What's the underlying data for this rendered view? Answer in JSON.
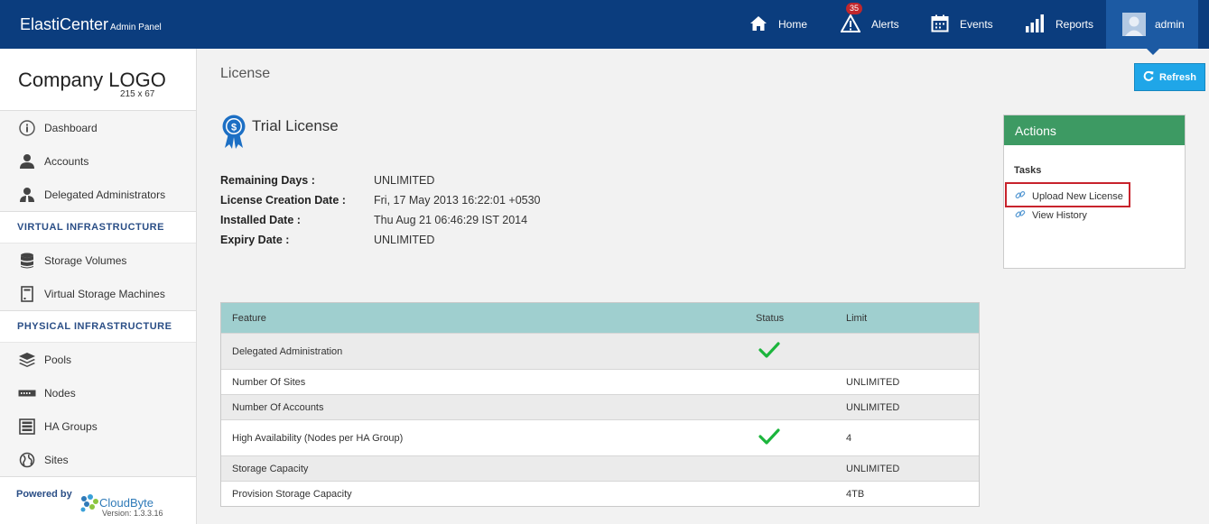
{
  "header": {
    "brand": "ElastiCenter",
    "brand_sub": "Admin Panel",
    "nav": [
      {
        "label": "Home",
        "icon": "home-icon"
      },
      {
        "label": "Alerts",
        "icon": "alert-icon",
        "badge": "35"
      },
      {
        "label": "Events",
        "icon": "calendar-icon"
      },
      {
        "label": "Reports",
        "icon": "bar-chart-icon"
      }
    ],
    "user": "admin"
  },
  "sidebar": {
    "logo": "Company LOGO",
    "logo_size": "215 x 67",
    "items_top": [
      "Dashboard",
      "Accounts",
      "Delegated Administrators"
    ],
    "section_virtual": "VIRTUAL INFRASTRUCTURE",
    "items_virtual": [
      "Storage Volumes",
      "Virtual Storage Machines"
    ],
    "section_physical": "PHYSICAL INFRASTRUCTURE",
    "items_physical": [
      "Pools",
      "Nodes",
      "HA Groups",
      "Sites"
    ],
    "powered_by": "Powered by",
    "vendor": "CloudByte",
    "version": "Version: 1.3.3.16"
  },
  "main": {
    "title": "License",
    "refresh": "Refresh",
    "license_title": "Trial License",
    "details": [
      {
        "key": "Remaining Days :",
        "value": "UNLIMITED"
      },
      {
        "key": "License Creation Date :",
        "value": "Fri, 17 May 2013 16:22:01 +0530"
      },
      {
        "key": "Installed Date :",
        "value": "Thu Aug 21 06:46:29 IST 2014"
      },
      {
        "key": "Expiry Date :",
        "value": "UNLIMITED"
      }
    ],
    "table": {
      "headers": [
        "Feature",
        "Status",
        "Limit"
      ],
      "rows": [
        {
          "feature": "Delegated Administration",
          "status": "check",
          "limit": ""
        },
        {
          "feature": "Number Of Sites",
          "status": "",
          "limit": "UNLIMITED"
        },
        {
          "feature": "Number Of Accounts",
          "status": "",
          "limit": "UNLIMITED"
        },
        {
          "feature": "High Availability (Nodes per HA Group)",
          "status": "check",
          "limit": "4"
        },
        {
          "feature": "Storage Capacity",
          "status": "",
          "limit": "UNLIMITED"
        },
        {
          "feature": "Provision Storage Capacity",
          "status": "",
          "limit": "4TB"
        }
      ]
    }
  },
  "actions": {
    "title": "Actions",
    "tasks": "Tasks",
    "links": [
      "Upload New License",
      "View History"
    ]
  },
  "colors": {
    "topbar": "#0b3d7e",
    "admin_box": "#1c5aa3",
    "refresh": "#1fa6e8",
    "actions_header": "#3d9a63",
    "table_header": "#9fcfcf",
    "highlight": "#c8232c",
    "check": "#1bb53c"
  }
}
